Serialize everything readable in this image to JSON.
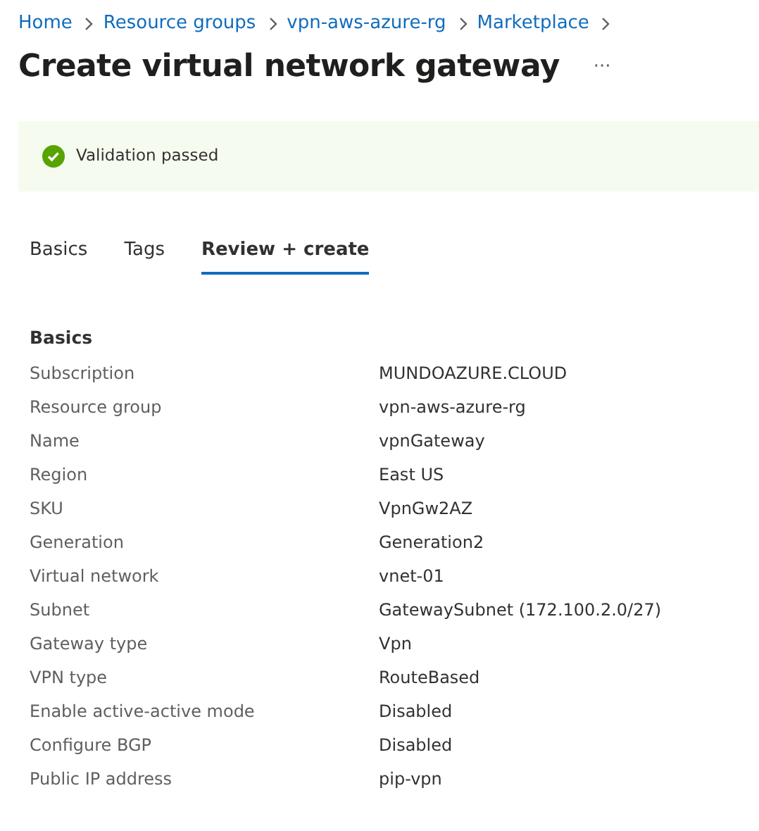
{
  "breadcrumb": [
    {
      "label": "Home"
    },
    {
      "label": "Resource groups"
    },
    {
      "label": "vpn-aws-azure-rg"
    },
    {
      "label": "Marketplace"
    }
  ],
  "title": "Create virtual network gateway",
  "more_button": "···",
  "banner": {
    "kind": "success",
    "text": "Validation passed"
  },
  "tabs": [
    {
      "label": "Basics",
      "selected": false
    },
    {
      "label": "Tags",
      "selected": false
    },
    {
      "label": "Review + create",
      "selected": true
    }
  ],
  "section": {
    "heading": "Basics",
    "rows": [
      {
        "label": "Subscription",
        "value": "MUNDOAZURE.CLOUD"
      },
      {
        "label": "Resource group",
        "value": "vpn-aws-azure-rg"
      },
      {
        "label": "Name",
        "value": "vpnGateway"
      },
      {
        "label": "Region",
        "value": "East US"
      },
      {
        "label": "SKU",
        "value": "VpnGw2AZ"
      },
      {
        "label": "Generation",
        "value": "Generation2"
      },
      {
        "label": "Virtual network",
        "value": "vnet-01"
      },
      {
        "label": "Subnet",
        "value": "GatewaySubnet (172.100.2.0/27)"
      },
      {
        "label": "Gateway type",
        "value": "Vpn"
      },
      {
        "label": "VPN type",
        "value": "RouteBased"
      },
      {
        "label": "Enable active-active mode",
        "value": "Disabled"
      },
      {
        "label": "Configure BGP",
        "value": "Disabled"
      },
      {
        "label": "Public IP address",
        "value": "pip-vpn"
      }
    ]
  }
}
